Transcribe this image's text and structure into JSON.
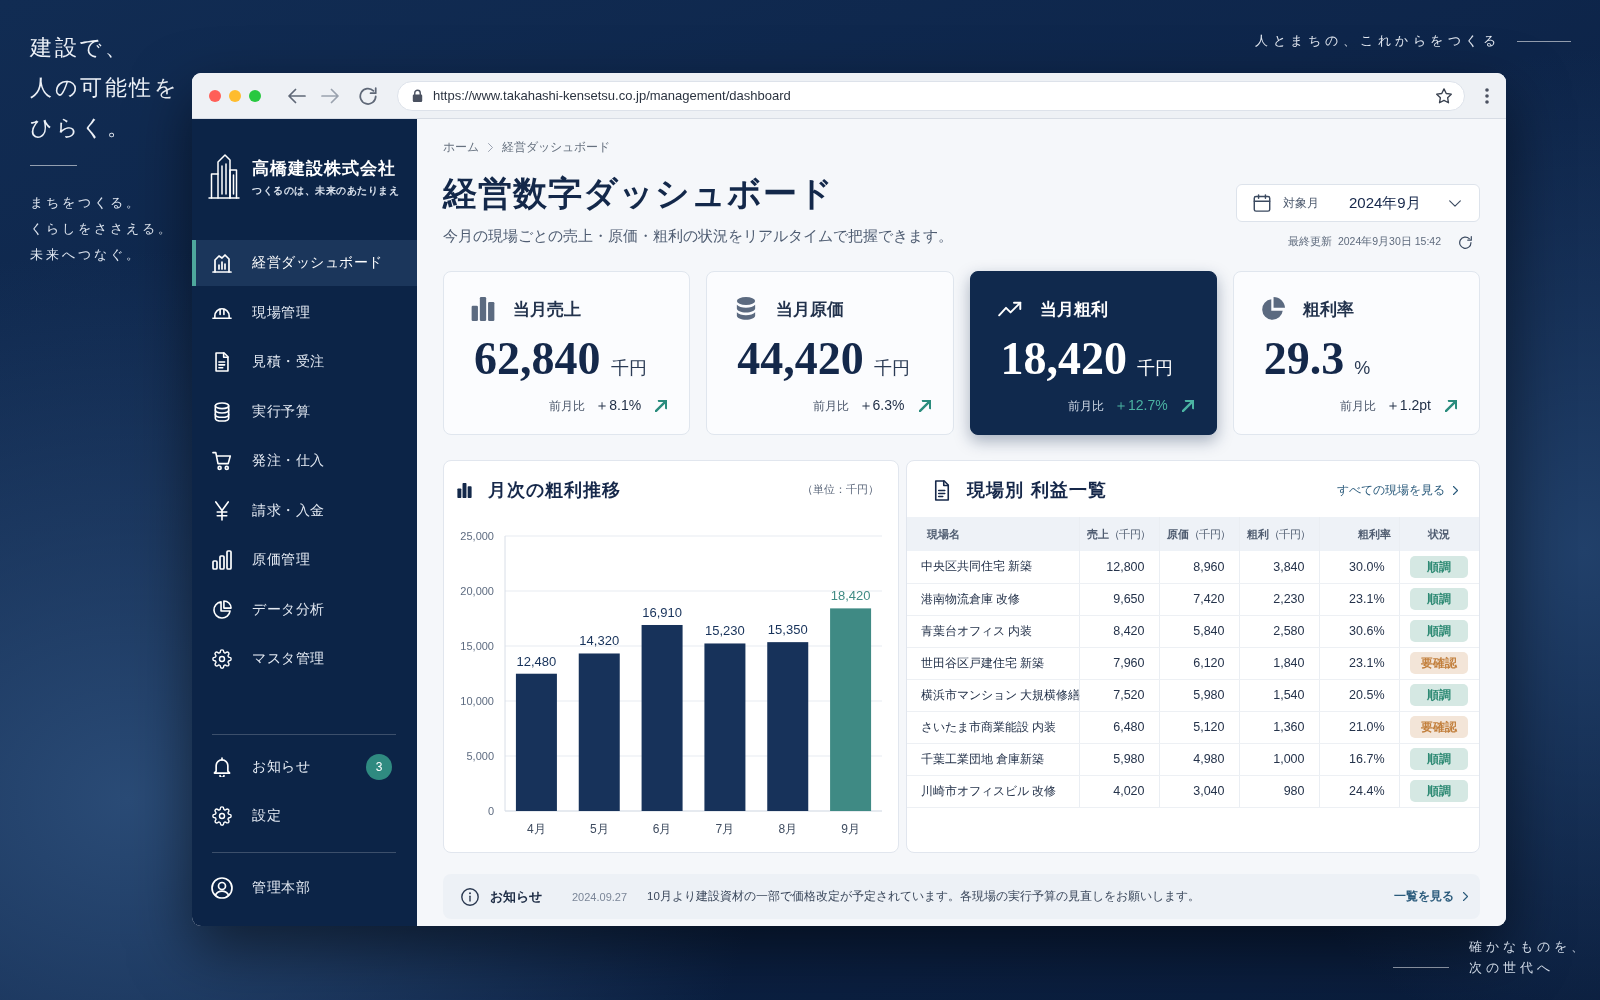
{
  "backdrop": {
    "headline": [
      "建設で、",
      "人の可能性を",
      "ひらく。"
    ],
    "tagline": [
      "まちをつくる。",
      "くらしをささえる。",
      "未来へつなぐ。"
    ],
    "catchphrase": "人とまちの、これからをつくる",
    "closing": [
      "確かなものを、",
      "次の世代へ"
    ]
  },
  "browser": {
    "url": "https://www.takahashi-kensetsu.co.jp/management/dashboard"
  },
  "sidebar": {
    "company": "高橋建設株式会社",
    "slogan": "つくるのは、未来のあたりまえ",
    "items": [
      {
        "label": "経営ダッシュボード",
        "selected": true
      },
      {
        "label": "現場管理",
        "selected": false
      },
      {
        "label": "見積・受注",
        "selected": false
      },
      {
        "label": "実行予算",
        "selected": false
      },
      {
        "label": "発注・仕入",
        "selected": false
      },
      {
        "label": "請求・入金",
        "selected": false
      },
      {
        "label": "原価管理",
        "selected": false
      },
      {
        "label": "データ分析",
        "selected": false
      },
      {
        "label": "マスタ管理",
        "selected": false
      }
    ],
    "footer_items": [
      {
        "label": "お知らせ",
        "badge": "3",
        "selected": false
      },
      {
        "label": "設定",
        "selected": false
      }
    ],
    "account": {
      "label": "管理本部"
    }
  },
  "header": {
    "breadcrumb": [
      {
        "label": "ホーム"
      },
      {
        "label": "経営ダッシュボード"
      }
    ],
    "title": "経営数字ダッシュボード",
    "subtitle": "今月の現場ごとの売上・原価・粗利の状況をリアルタイムで把握できます。",
    "period": {
      "label": "対象月",
      "value": "2024年9月"
    },
    "last_updated": {
      "label": "最終更新",
      "value": "2024年9月30日 15:42"
    }
  },
  "kpis": [
    {
      "label": "当月売上",
      "value": "62,840",
      "unit": "千円",
      "change_label": "前月比",
      "change": "＋8.1%",
      "highlighted": false
    },
    {
      "label": "当月原価",
      "value": "44,420",
      "unit": "千円",
      "change_label": "前月比",
      "change": "＋6.3%",
      "highlighted": false
    },
    {
      "label": "当月粗利",
      "value": "18,420",
      "unit": "千円",
      "change_label": "前月比",
      "change": "＋12.7%",
      "highlighted": true
    },
    {
      "label": "粗利率",
      "value": "29.3",
      "unit": "%",
      "change_label": "前月比",
      "change": "＋1.2pt",
      "highlighted": false
    }
  ],
  "profit_chart": {
    "title": "月次の粗利推移",
    "unit": "（単位：千円）",
    "chart_data": {
      "type": "bar",
      "categories": [
        "4月",
        "5月",
        "6月",
        "7月",
        "8月",
        "9月"
      ],
      "series": [
        {
          "color": "#17325a",
          "values": [
            12480,
            14320,
            16910,
            15230,
            15350,
            null
          ]
        },
        {
          "color": "#3f8a84",
          "values": [
            null,
            null,
            null,
            null,
            null,
            18420
          ]
        }
      ],
      "stacked": true,
      "ylim": [
        0,
        25000
      ],
      "yticks": [
        {
          "value": 0,
          "label": "0"
        },
        {
          "value": 5000,
          "label": "5,000"
        },
        {
          "value": 10000,
          "label": "10,000"
        },
        {
          "value": 15000,
          "label": "15,000"
        },
        {
          "value": 20000,
          "label": "20,000"
        },
        {
          "value": 25000,
          "label": "25,000"
        }
      ],
      "grid": true,
      "value_labels": [
        "12,480",
        "14,320",
        "16,910",
        "15,230",
        "15,350",
        "18,420"
      ]
    }
  },
  "site_table": {
    "title": "現場別 利益一覧",
    "link": "すべての現場を見る",
    "columns": [
      {
        "label": "現場名"
      },
      {
        "label": "売上",
        "unit": "（千円）"
      },
      {
        "label": "原価",
        "unit": "（千円）"
      },
      {
        "label": "粗利",
        "unit": "（千円）"
      },
      {
        "label": "粗利率"
      },
      {
        "label": "状況"
      }
    ],
    "rows": [
      {
        "cells": [
          "中央区共同住宅 新築",
          "12,800",
          "8,960",
          "3,840",
          "30.0%"
        ],
        "status": {
          "label": "順調",
          "color": "#2e8a74"
        }
      },
      {
        "cells": [
          "港南物流倉庫 改修",
          "9,650",
          "7,420",
          "2,230",
          "23.1%"
        ],
        "status": {
          "label": "順調",
          "color": "#2e8a74"
        }
      },
      {
        "cells": [
          "青葉台オフィス 内装",
          "8,420",
          "5,840",
          "2,580",
          "30.6%"
        ],
        "status": {
          "label": "順調",
          "color": "#2e8a74"
        }
      },
      {
        "cells": [
          "世田谷区戸建住宅 新築",
          "7,960",
          "6,120",
          "1,840",
          "23.1%"
        ],
        "status": {
          "label": "要確認",
          "color": "#c27f3c"
        }
      },
      {
        "cells": [
          "横浜市マンション 大規横修繕",
          "7,520",
          "5,980",
          "1,540",
          "20.5%"
        ],
        "status": {
          "label": "順調",
          "color": "#2e8a74"
        }
      },
      {
        "cells": [
          "さいたま市商業能設 内装",
          "6,480",
          "5,120",
          "1,360",
          "21.0%"
        ],
        "status": {
          "label": "要確認",
          "color": "#c27f3c"
        }
      },
      {
        "cells": [
          "千葉工業団地 倉庫新築",
          "5,980",
          "4,980",
          "1,000",
          "16.7%"
        ],
        "status": {
          "label": "順調",
          "color": "#2e8a74"
        }
      },
      {
        "cells": [
          "川崎市オフィスビル 改修",
          "4,020",
          "3,040",
          "980",
          "24.4%"
        ],
        "status": {
          "label": "順調",
          "color": "#2e8a74"
        }
      }
    ]
  },
  "notice": {
    "title": "お知らせ",
    "date": "2024.09.27",
    "message": "10月より建設資材の一部で価格改定が予定されています。各現場の実行予算の見直しをお願いします。",
    "link": "一覧を見る"
  }
}
